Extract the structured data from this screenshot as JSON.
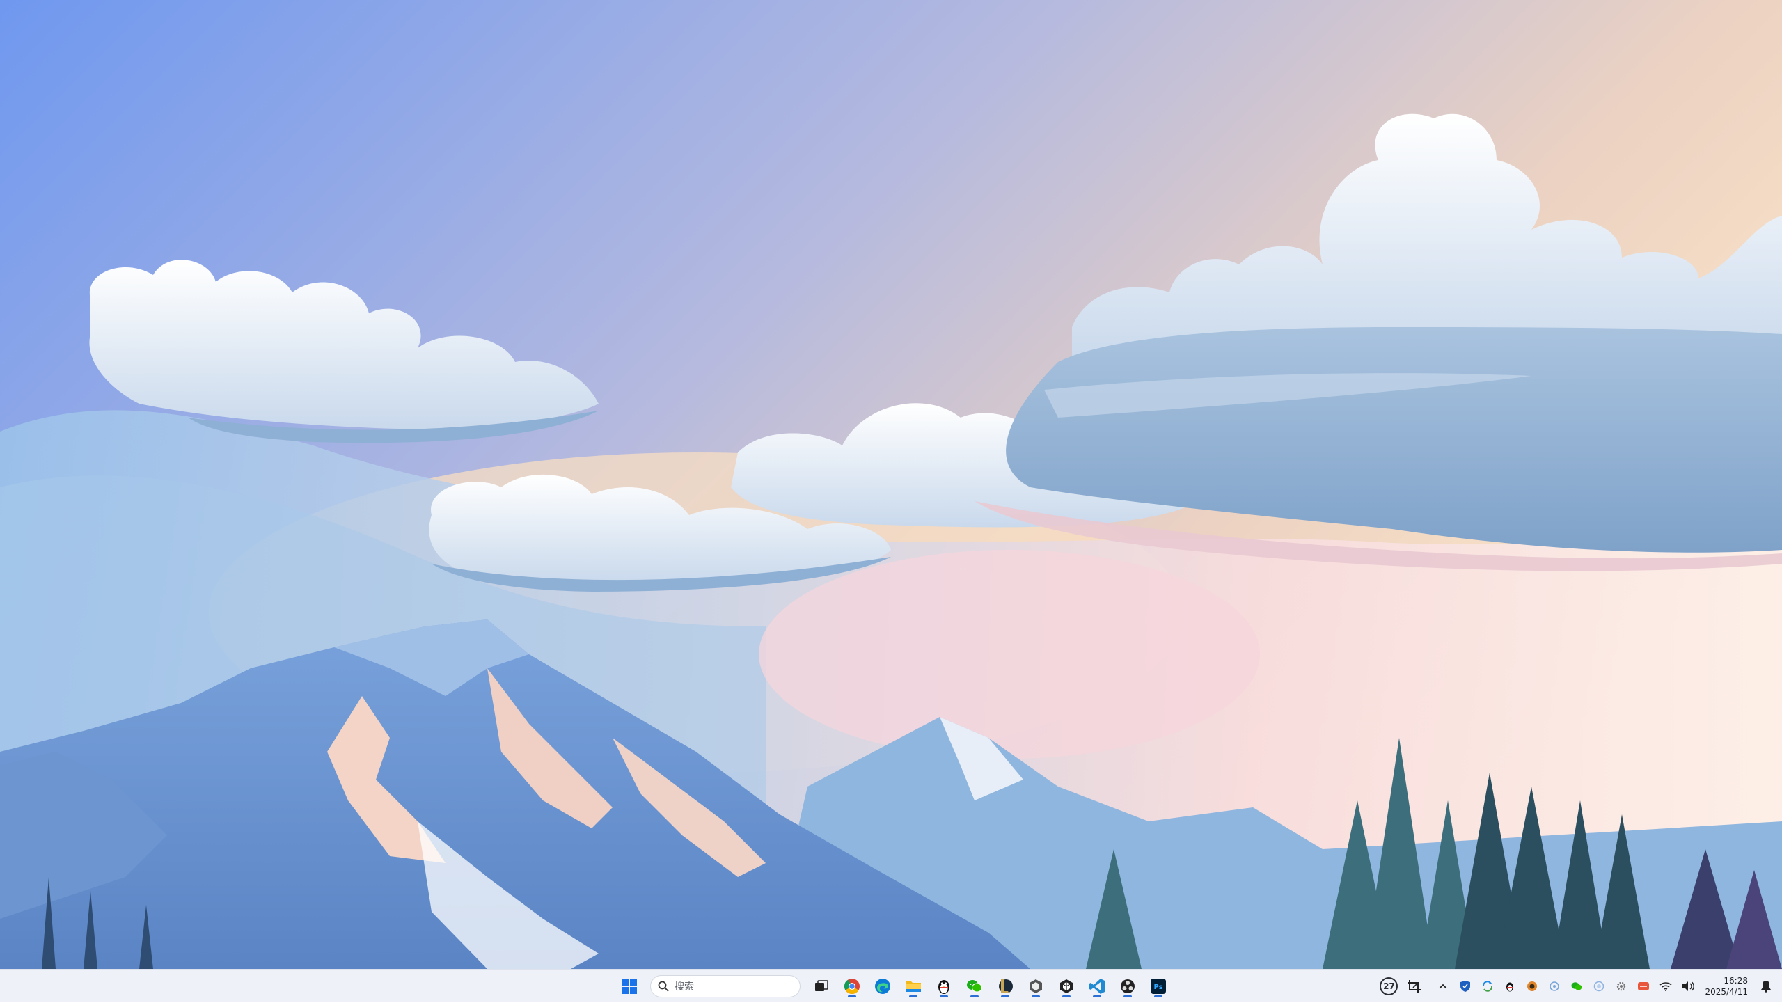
{
  "taskbar": {
    "search": {
      "placeholder": "搜索"
    },
    "apps": [
      {
        "name": "start-button"
      },
      {
        "name": "task-view"
      },
      {
        "name": "chrome"
      },
      {
        "name": "edge"
      },
      {
        "name": "file-explorer"
      },
      {
        "name": "qq"
      },
      {
        "name": "wechat"
      },
      {
        "name": "league-client"
      },
      {
        "name": "unity-hub"
      },
      {
        "name": "unity"
      },
      {
        "name": "vscode"
      },
      {
        "name": "obs"
      },
      {
        "name": "photoshop"
      }
    ],
    "tray": {
      "weather_temp": "27",
      "clock_time": "16:28",
      "clock_date": "2025/4/11",
      "ps_label": "Ps"
    }
  },
  "colors": {
    "accent": "#2b6fd6",
    "taskbar_bg": "#eef1f8"
  }
}
